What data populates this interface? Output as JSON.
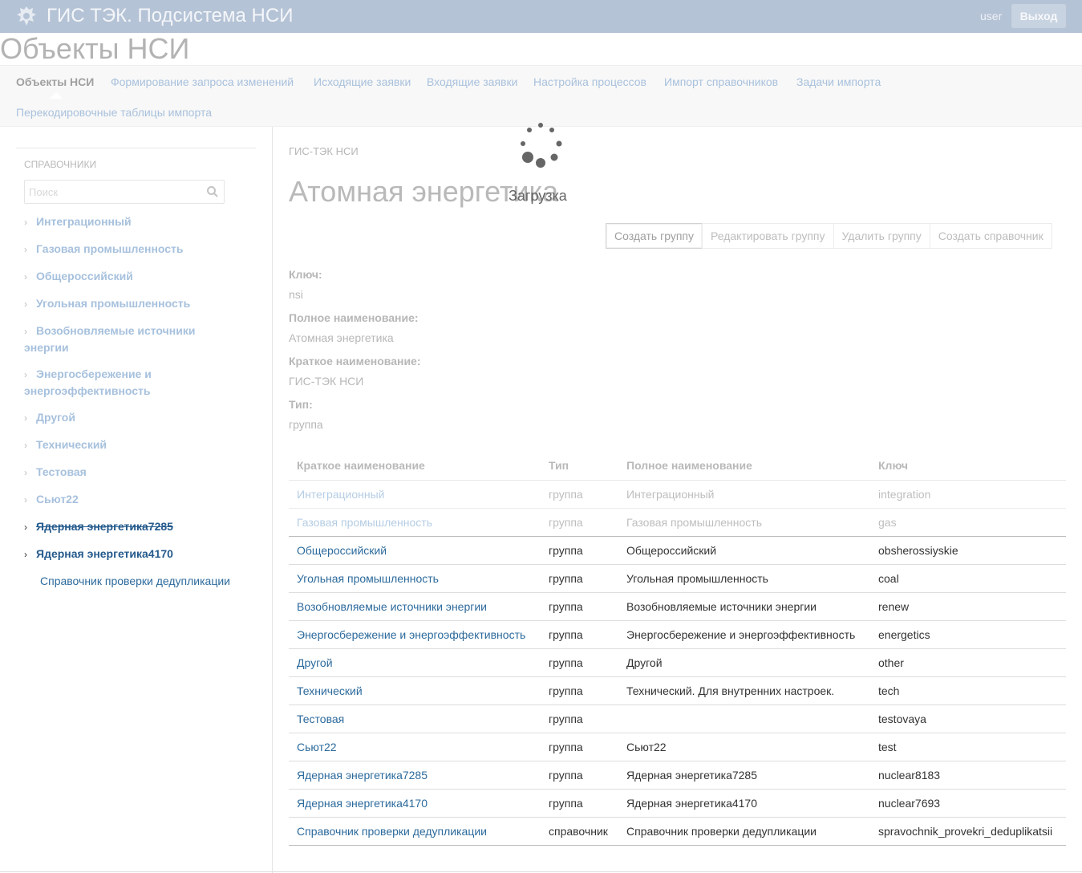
{
  "header": {
    "app_title": "ГИС ТЭК. Подсистема НСИ",
    "user": "user",
    "logout_label": "Выход"
  },
  "page": {
    "title": "Объекты НСИ"
  },
  "tabs": [
    {
      "label": "Объекты НСИ",
      "active": true
    },
    {
      "label": "Формирование запроса изменений"
    },
    {
      "label": "Исходящие заявки"
    },
    {
      "label": "Входящие заявки"
    },
    {
      "label": "Настройка процессов"
    },
    {
      "label": "Импорт справочников"
    },
    {
      "label": "Задачи импорта"
    },
    {
      "label": "Перекодировочные таблицы импорта"
    }
  ],
  "sidebar": {
    "section_title": "СПРАВОЧНИКИ",
    "search_placeholder": "Поиск",
    "items": [
      {
        "label": "Интеграционный"
      },
      {
        "label": "Газовая промышленность"
      },
      {
        "label": "Общероссийский"
      },
      {
        "label": "Угольная промышленность"
      },
      {
        "label": "Возобновляемые источники энергии"
      },
      {
        "label": "Энергосбережение и энергоэффективность"
      },
      {
        "label": "Другой"
      },
      {
        "label": "Технический"
      },
      {
        "label": "Тестовая"
      },
      {
        "label": "Сьют22"
      },
      {
        "label": "Ядерная энергетика7285"
      },
      {
        "label": "Ядерная энергетика4170"
      }
    ],
    "child": "Справочник проверки дедупликации"
  },
  "main": {
    "breadcrumb": "ГИС-ТЭК НСИ",
    "title": "Атомная энергетика",
    "loading_label": "Загрузка",
    "buttons": {
      "create_group": "Создать группу",
      "edit_group": "Редактировать группу",
      "delete_group": "Удалить группу",
      "create_directory": "Создать справочник"
    },
    "properties": [
      {
        "label": "Ключ:",
        "value": "nsi"
      },
      {
        "label": "Полное наименование:",
        "value": "Атомная энергетика"
      },
      {
        "label": "Краткое наименование:",
        "value": "ГИС-ТЭК НСИ"
      },
      {
        "label": "Тип:",
        "value": "группа"
      }
    ],
    "table": {
      "headers": [
        "Краткое наименование",
        "Тип",
        "Полное наименование",
        "Ключ"
      ],
      "rows": [
        {
          "short": "Интеграционный",
          "type": "группа",
          "full": "Интеграционный",
          "key": "integration"
        },
        {
          "short": "Газовая промышленность",
          "type": "группа",
          "full": "Газовая промышленность",
          "key": "gas"
        },
        {
          "short": "Общероссийский",
          "type": "группа",
          "full": "Общероссийский",
          "key": "obsherossiyskie"
        },
        {
          "short": "Угольная промышленность",
          "type": "группа",
          "full": "Угольная промышленность",
          "key": "coal"
        },
        {
          "short": "Возобновляемые источники энергии",
          "type": "группа",
          "full": "Возобновляемые источники энергии",
          "key": "renew"
        },
        {
          "short": "Энергосбережение и энергоэффективность",
          "type": "группа",
          "full": "Энергосбережение и энергоэффективность",
          "key": "energetics"
        },
        {
          "short": "Другой",
          "type": "группа",
          "full": "Другой",
          "key": "other"
        },
        {
          "short": "Технический",
          "type": "группа",
          "full": "Технический. Для внутренних настроек.",
          "key": "tech"
        },
        {
          "short": "Тестовая",
          "type": "группа",
          "full": "",
          "key": "testovaya"
        },
        {
          "short": "Сьют22",
          "type": "группа",
          "full": "Сьют22",
          "key": "test"
        },
        {
          "short": "Ядерная энергетика7285",
          "type": "группа",
          "full": "Ядерная энергетика7285",
          "key": "nuclear8183"
        },
        {
          "short": "Ядерная энергетика4170",
          "type": "группа",
          "full": "Ядерная энергетика4170",
          "key": "nuclear7693"
        },
        {
          "short": "Справочник проверки дедупликации",
          "type": "справочник",
          "full": "Справочник проверки дедупликации",
          "key": "spravochnik_provekri_deduplikatsii"
        }
      ]
    }
  }
}
